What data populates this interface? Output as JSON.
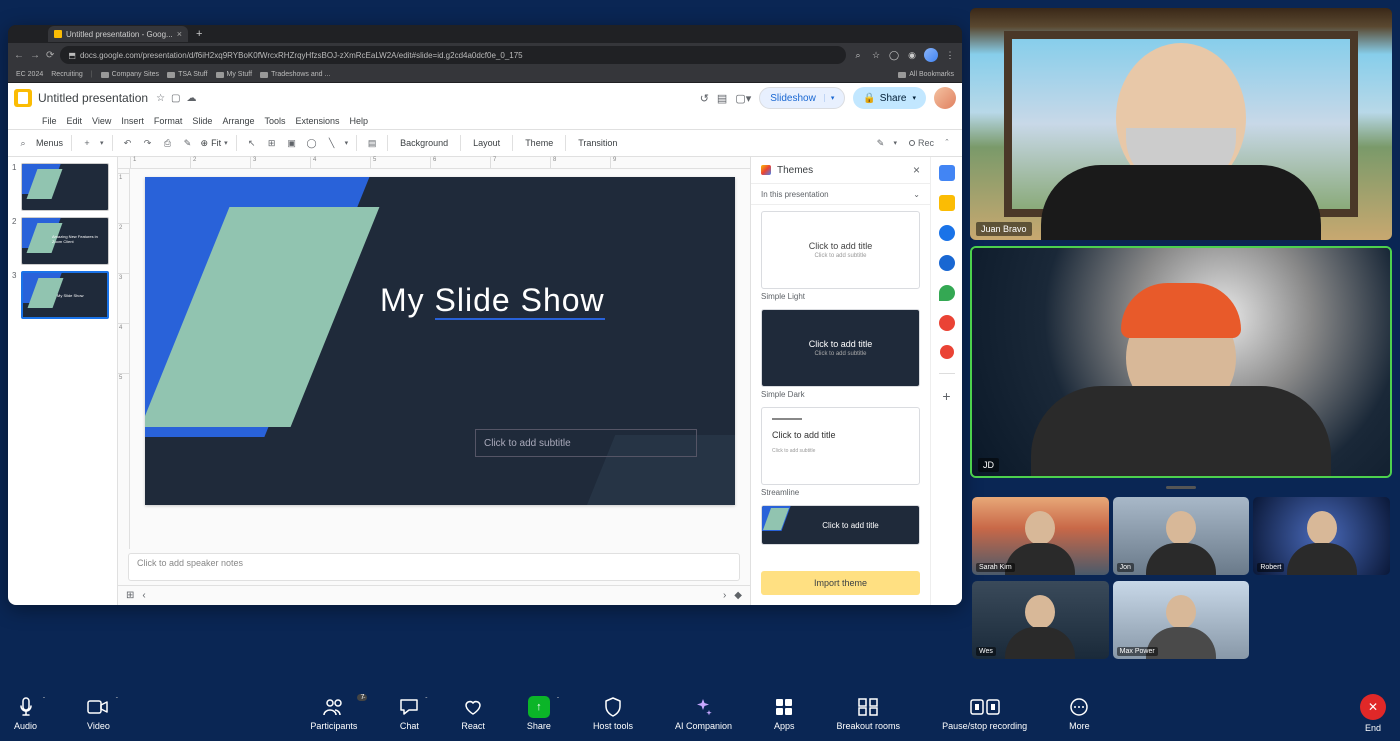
{
  "browser": {
    "tab_title": "Untitled presentation - Goog...",
    "url": "docs.google.com/presentation/d/f6iH2xq9RYBoK0fWrcxRHZrqyHfzsBOJ-zXmRcEaLW2A/edit#slide=id.g2cd4a0dcf0e_0_175",
    "bookmarks": [
      "EC 2024",
      "Recruiting",
      "Company Sites",
      "TSA Stuff",
      "My Stuff",
      "Tradeshows and ..."
    ],
    "bookmarks_right": "All Bookmarks"
  },
  "slides": {
    "doc_title": "Untitled presentation",
    "menus": [
      "File",
      "Edit",
      "View",
      "Insert",
      "Format",
      "Slide",
      "Arrange",
      "Tools",
      "Extensions",
      "Help"
    ],
    "slideshow_label": "Slideshow",
    "share_label": "Share",
    "toolbar": {
      "menus_label": "Menus",
      "zoom": "Fit",
      "background": "Background",
      "layout": "Layout",
      "theme": "Theme",
      "transition": "Transition",
      "rec": "Rec"
    },
    "thumbnails": [
      {
        "num": "1",
        "text": ""
      },
      {
        "num": "2",
        "text": "Amazing New Features in Zoom Client"
      },
      {
        "num": "3",
        "text": "My Slide Show"
      }
    ],
    "slide_title_a": "My ",
    "slide_title_b": "Slide Show",
    "subtitle_placeholder": "Click to add subtitle",
    "speaker_notes_placeholder": "Click to add speaker notes",
    "themes": {
      "header": "Themes",
      "section": "In this presentation",
      "preview_title": "Click to add title",
      "preview_sub": "Click to add subtitle",
      "items": [
        "Simple Light",
        "Simple Dark",
        "Streamline"
      ],
      "import": "Import theme"
    },
    "ruler_h": [
      "1",
      "2",
      "3",
      "4",
      "5",
      "6",
      "7",
      "8",
      "9"
    ]
  },
  "zoom": {
    "participants": {
      "count": "7",
      "p1": "Juan Bravo",
      "p2": "JD",
      "gallery": [
        "Sarah Kim",
        "Jon",
        "Robert",
        "Wes",
        "Max Power"
      ]
    },
    "toolbar": {
      "audio": "Audio",
      "video": "Video",
      "participants": "Participants",
      "chat": "Chat",
      "react": "React",
      "share": "Share",
      "host_tools": "Host tools",
      "ai": "AI Companion",
      "apps": "Apps",
      "breakout": "Breakout rooms",
      "record": "Pause/stop recording",
      "more": "More",
      "end": "End"
    }
  }
}
